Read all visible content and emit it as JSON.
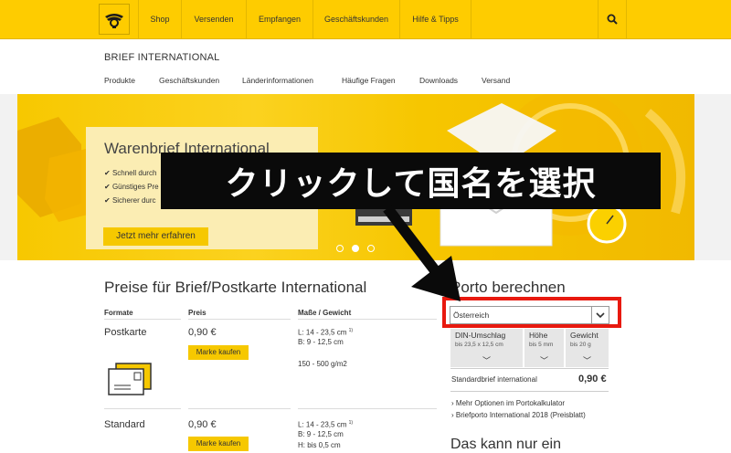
{
  "colors": {
    "brand_yellow": "#fecc00",
    "button_yellow": "#f6c800",
    "overlay_black": "#0a0a0a",
    "highlight_red": "#e8190f"
  },
  "top_nav": {
    "logo_icon": "posthorn-icon",
    "items": [
      "Shop",
      "Versenden",
      "Empfangen",
      "Geschäftskunden",
      "Hilfe & Tipps"
    ],
    "search_icon": "search-icon"
  },
  "sub_header": {
    "title": "BRIEF INTERNATIONAL",
    "nav": [
      "Produkte",
      "Geschäftskunden",
      "Länderinformationen",
      "Häufige Fragen",
      "Downloads",
      "Versand"
    ]
  },
  "hero": {
    "title": "Warenbrief International",
    "bullets": [
      "Schnell durch",
      "Günstiges Pre",
      "Sicherer durc"
    ],
    "button": "Jetzt mehr erfahren",
    "dots": 3,
    "active_dot": 1
  },
  "overlay": {
    "text": "クリックして国名を選択"
  },
  "prices": {
    "title": "Preise für Brief/Postkarte International",
    "headers": [
      "Formate",
      "Preis",
      "Maße / Gewicht"
    ],
    "rows": [
      {
        "format": "Postkarte",
        "price": "0,90 €",
        "button": "Marke kaufen",
        "l": "L: 14 - 23,5 cm",
        "l_sup": "1)",
        "b": "B: 9 - 12,5 cm",
        "extra": "150 - 500 g/m2"
      },
      {
        "format": "Standard",
        "price": "0,90 €",
        "button": "Marke kaufen",
        "l": "L: 14 - 23,5 cm",
        "l_sup": "1)",
        "b": "B: 9 - 12,5 cm",
        "extra": "H: bis 0,5 cm"
      }
    ]
  },
  "porto": {
    "title": "Porto berechnen",
    "country": "Österreich",
    "params": [
      {
        "label": "DIN-Umschlag",
        "sub": "bis 23,5 x 12,5 cm"
      },
      {
        "label": "Höhe",
        "sub": "bis 5 mm"
      },
      {
        "label": "Gewicht",
        "sub": "bis 20 g"
      }
    ],
    "result_label": "Standardbrief international",
    "result_price": "0,90 €",
    "links": [
      "Mehr Optionen im Portokalkulator",
      "Briefporto International 2018 (Preisblatt)"
    ],
    "next_title": "Das kann nur ein"
  }
}
